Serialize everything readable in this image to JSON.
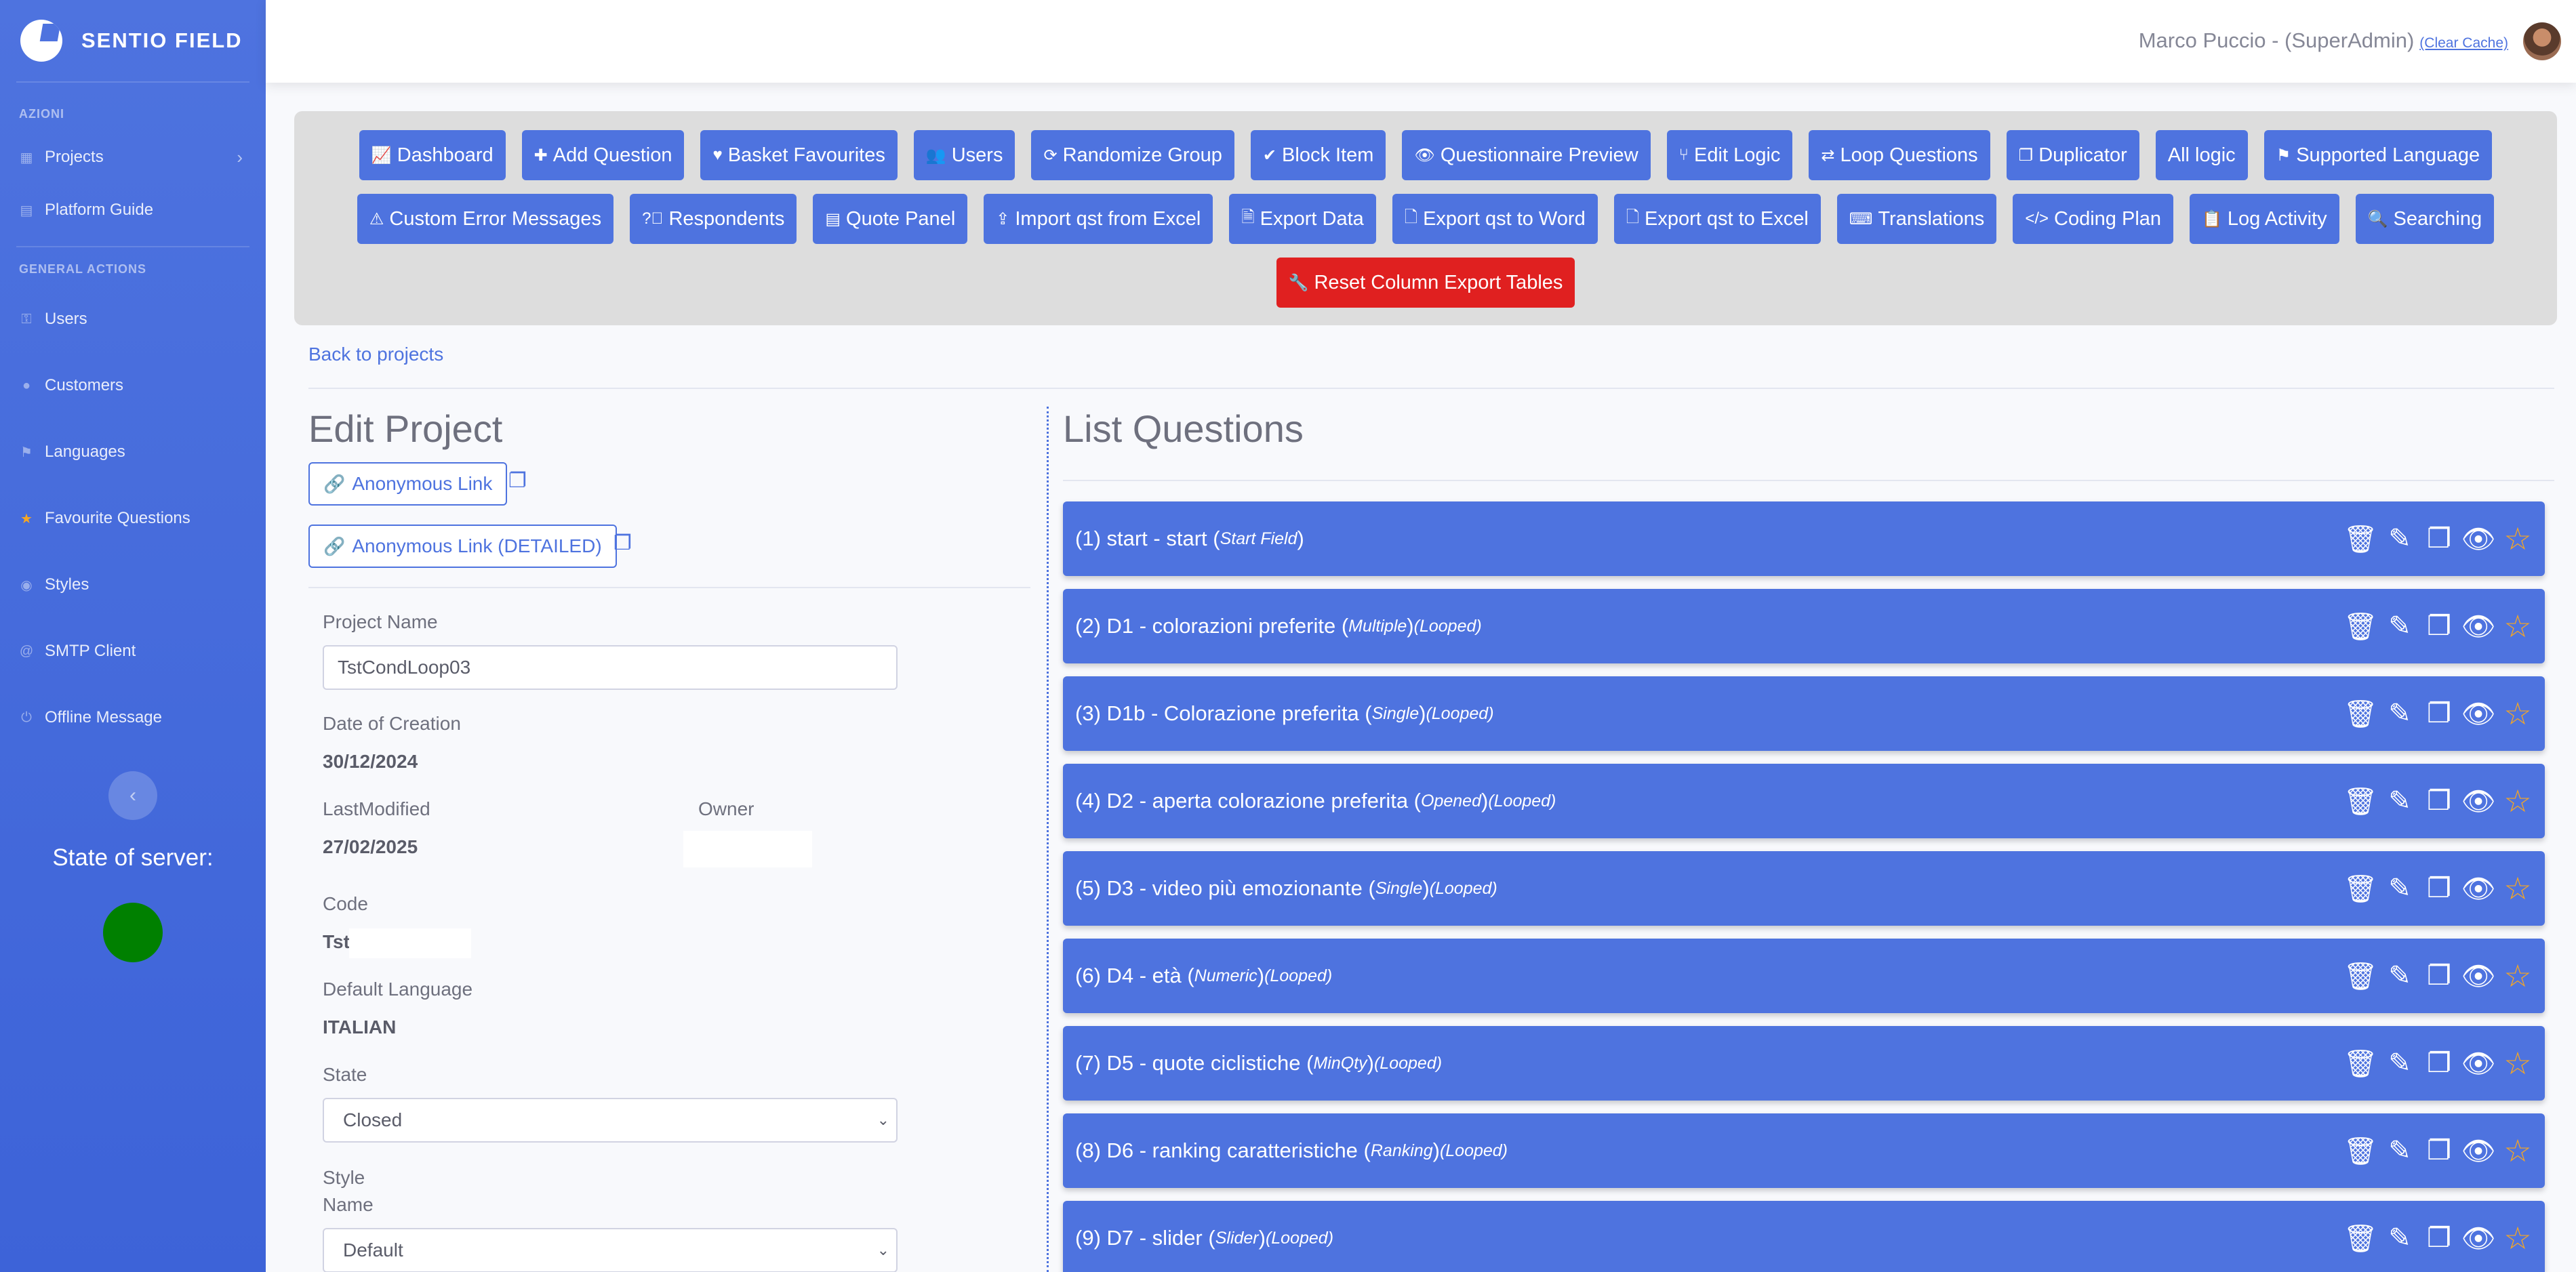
{
  "brand": {
    "name": "SENTIO FIELD"
  },
  "sidebar": {
    "heading_actions": "AZIONI",
    "projects": "Projects",
    "platform_guide": "Platform Guide",
    "heading_general": "GENERAL ACTIONS",
    "items": [
      {
        "label": "Users",
        "icon": "key-icon"
      },
      {
        "label": "Customers",
        "icon": "users-icon"
      },
      {
        "label": "Languages",
        "icon": "flag-icon"
      },
      {
        "label": "Favourite Questions",
        "icon": "star-icon"
      },
      {
        "label": "Styles",
        "icon": "palette-icon"
      },
      {
        "label": "SMTP Client",
        "icon": "at-icon"
      },
      {
        "label": "Offline Message",
        "icon": "power-icon"
      }
    ],
    "server_state_label": "State of server:",
    "server_state_color": "#008000"
  },
  "topbar": {
    "user": "Marco Puccio - (SuperAdmin)",
    "clear_cache": "(Clear Cache)"
  },
  "toolbar": {
    "row1": [
      "Dashboard",
      "Add Question",
      "Basket Favourites",
      "Users",
      "Randomize Group",
      "Block Item",
      "Questionnaire Preview",
      "Edit Logic",
      "Loop Questions",
      "Duplicator",
      "All logic",
      "Supported Language"
    ],
    "row2": [
      "Custom Error Messages",
      "Respondents",
      "Quote Panel",
      "Import qst from Excel",
      "Export Data",
      "Export qst to Word",
      "Export qst to Excel",
      "Translations",
      "Coding Plan",
      "Log Activity",
      "Searching"
    ],
    "reset": "Reset Column Export Tables"
  },
  "content": {
    "back_link": "Back to projects",
    "edit_title": "Edit Project",
    "anon_link": "Anonymous Link",
    "anon_link_detailed": "Anonymous Link (DETAILED)",
    "project_name_label": "Project Name",
    "project_name_value": "TstCondLoop03",
    "date_creation_label": "Date of Creation",
    "date_creation_value": "30/12/2024",
    "last_modified_label": "LastModified",
    "last_modified_value": "27/02/2025",
    "owner_label": "Owner",
    "code_label": "Code",
    "code_value": "Tst",
    "default_language_label": "Default Language",
    "default_language_value": "ITALIAN",
    "state_label": "State",
    "state_value": "Closed",
    "style_label": "Style",
    "style_name_label": "Name",
    "style_value": "Default"
  },
  "list": {
    "title": "List Questions",
    "questions": [
      {
        "text": "(1) start - start (",
        "type": "Start Field",
        "suffix": ")",
        "looped": ""
      },
      {
        "text": "(2) D1 - colorazioni preferite (",
        "type": "Multiple",
        "suffix": ")",
        "looped": "(Looped)"
      },
      {
        "text": "(3) D1b - Colorazione preferita (",
        "type": "Single",
        "suffix": ")",
        "looped": "(Looped)"
      },
      {
        "text": "(4) D2 - aperta colorazione preferita (",
        "type": "Opened",
        "suffix": ")",
        "looped": "(Looped)"
      },
      {
        "text": "(5) D3 - video più emozionante (",
        "type": "Single",
        "suffix": ")",
        "looped": "(Looped)"
      },
      {
        "text": "(6) D4 - età (",
        "type": "Numeric",
        "suffix": ")",
        "looped": "(Looped)"
      },
      {
        "text": "(7) D5 - quote ciclistiche (",
        "type": "MinQty",
        "suffix": ")",
        "looped": "(Looped)"
      },
      {
        "text": "(8) D6 - ranking caratteristiche (",
        "type": "Ranking",
        "suffix": ")",
        "looped": "(Looped)"
      },
      {
        "text": "(9) D7 - slider (",
        "type": "Slider",
        "suffix": ")",
        "looped": "(Looped)"
      }
    ]
  }
}
